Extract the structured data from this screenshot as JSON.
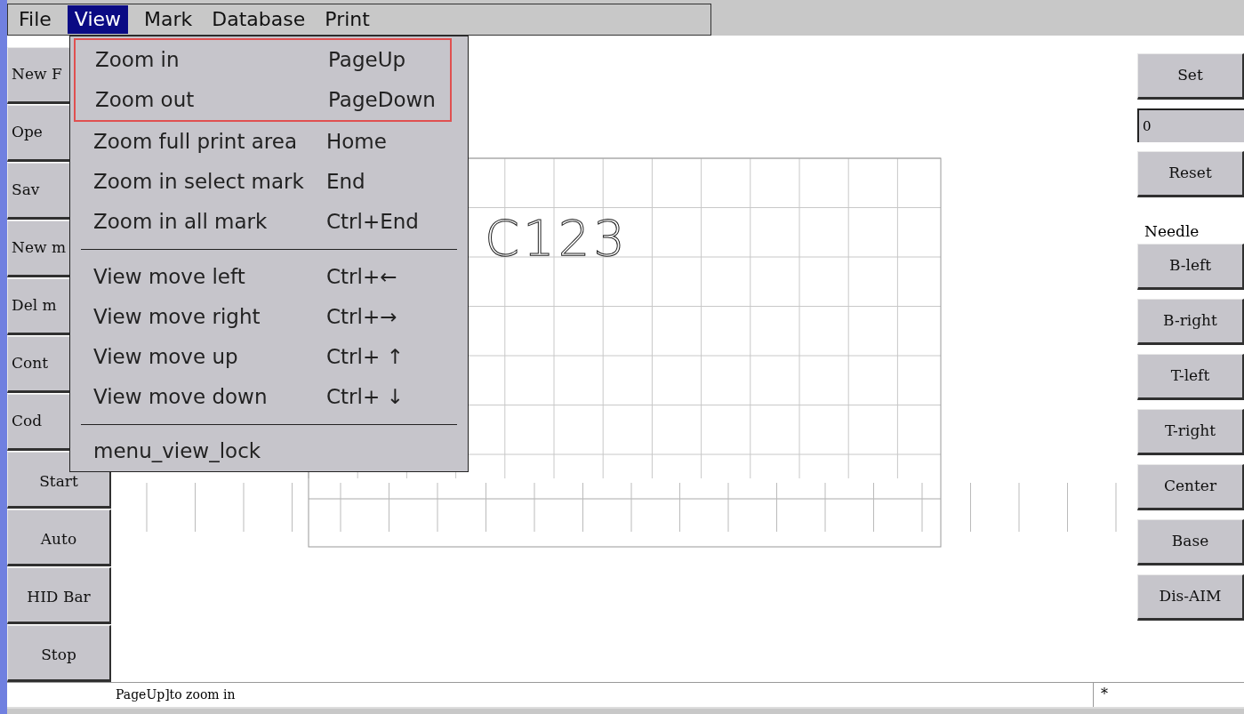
{
  "menubar": [
    {
      "label": "File",
      "selected": false
    },
    {
      "label": "View",
      "selected": true
    },
    {
      "label": "Mark",
      "selected": false
    },
    {
      "label": "Database",
      "selected": false
    },
    {
      "label": "Print",
      "selected": false
    }
  ],
  "view_menu": [
    {
      "kind": "outlined",
      "items": [
        {
          "label": "Zoom in",
          "shortcut": "PageUp"
        },
        {
          "label": "Zoom out",
          "shortcut": "PageDown"
        }
      ]
    },
    {
      "kind": "plain",
      "items": [
        {
          "label": "Zoom full print area",
          "shortcut": "Home"
        },
        {
          "label": "Zoom in select mark",
          "shortcut": "End"
        },
        {
          "label": "Zoom in all mark",
          "shortcut": "Ctrl+End"
        }
      ]
    },
    {
      "kind": "separator"
    },
    {
      "kind": "plain",
      "items": [
        {
          "label": "View move left",
          "shortcut": "Ctrl+←"
        },
        {
          "label": "View move right",
          "shortcut": "Ctrl+→"
        },
        {
          "label": "View move up",
          "shortcut": "Ctrl+ ↑"
        },
        {
          "label": "View move down",
          "shortcut": "Ctrl+ ↓"
        }
      ]
    },
    {
      "kind": "separator"
    },
    {
      "kind": "plain",
      "items": [
        {
          "label": "menu_view_lock"
        }
      ]
    }
  ],
  "left_buttons": [
    {
      "label": "New F",
      "cut": true
    },
    {
      "label": "Ope",
      "cut": true
    },
    {
      "label": "Sav",
      "cut": true
    },
    {
      "label": "New m",
      "cut": true
    },
    {
      "label": "Del m",
      "cut": true
    },
    {
      "label": "Cont",
      "cut": true
    },
    {
      "label": "Cod",
      "cut": true
    },
    {
      "label": "Start",
      "cut": false
    },
    {
      "label": "Auto",
      "cut": false
    },
    {
      "label": "HID Bar",
      "cut": false
    },
    {
      "label": "Stop",
      "cut": false
    }
  ],
  "canvas": {
    "mark_text": "C123"
  },
  "right_panel": [
    {
      "kind": "button",
      "label": "Set"
    },
    {
      "kind": "field",
      "value": "0"
    },
    {
      "kind": "button",
      "label": "Reset"
    },
    {
      "kind": "label",
      "label": "Needle"
    },
    {
      "kind": "button",
      "label": "B-left"
    },
    {
      "kind": "button",
      "label": "B-right"
    },
    {
      "kind": "button",
      "label": "T-left"
    },
    {
      "kind": "button",
      "label": "T-right"
    },
    {
      "kind": "button",
      "label": "Center"
    },
    {
      "kind": "button",
      "label": "Base"
    },
    {
      "kind": "button",
      "label": "Dis-AIM"
    }
  ],
  "status_bar": {
    "message": "PageUp]to zoom in",
    "indicator": "*"
  }
}
